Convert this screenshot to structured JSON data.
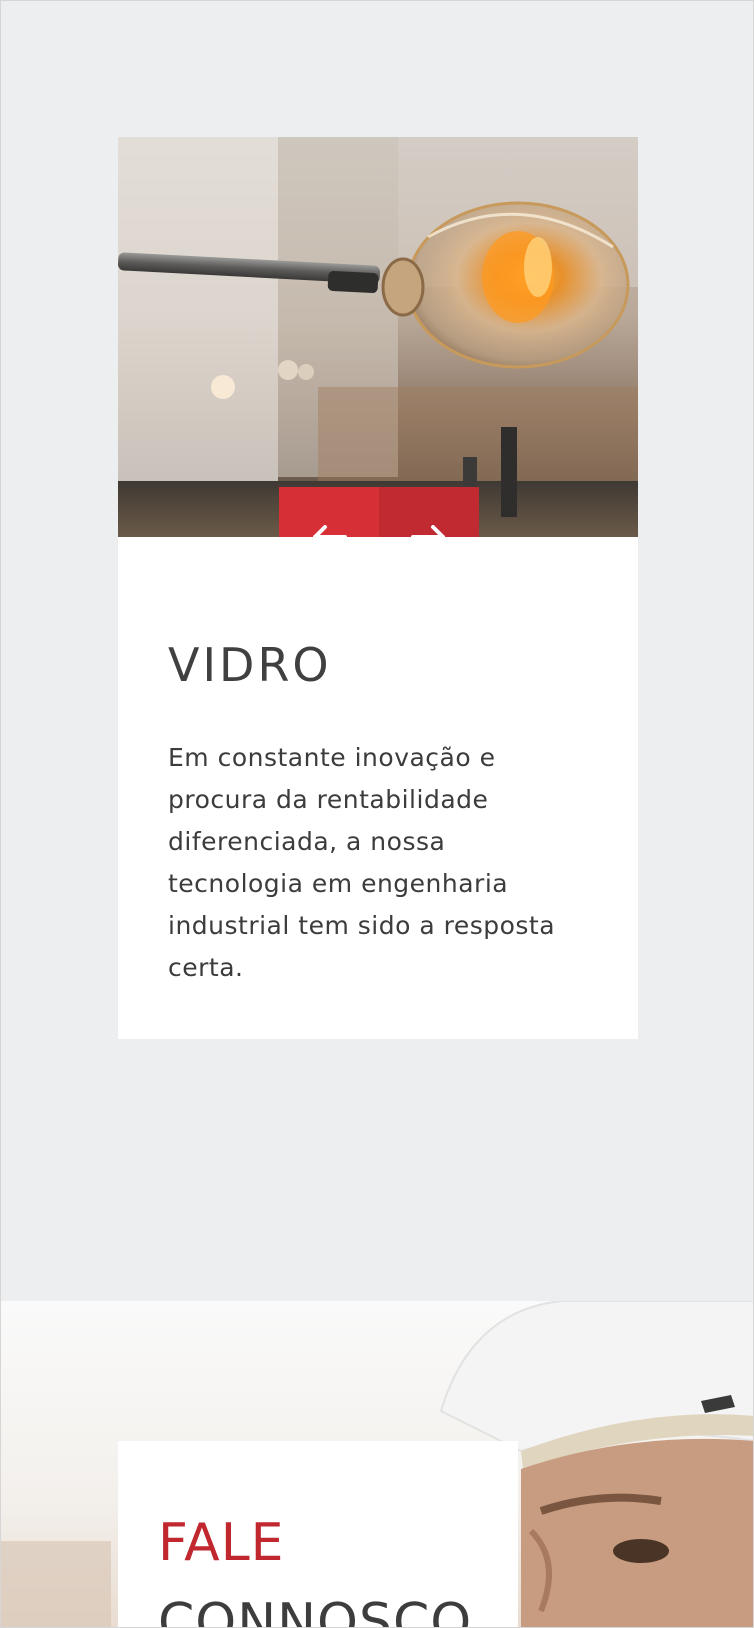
{
  "slider": {
    "image_alt": "glass-blowing-photo",
    "prev_icon": "arrow-left-icon",
    "next_icon": "arrow-right-icon",
    "title": "VIDRO",
    "text": "Em constante inovação e procura da rentabilidade diferenciada, a nossa tecnologia em engenharia industrial tem sido a resposta certa."
  },
  "contact": {
    "title_line_1": "FALE",
    "title_line_2": "CONNOSCO"
  },
  "colors": {
    "background": "#edeef0",
    "accent_red": "#d72f36",
    "accent_red_dark": "#c22a32",
    "text_dark": "#3c3c3c"
  }
}
